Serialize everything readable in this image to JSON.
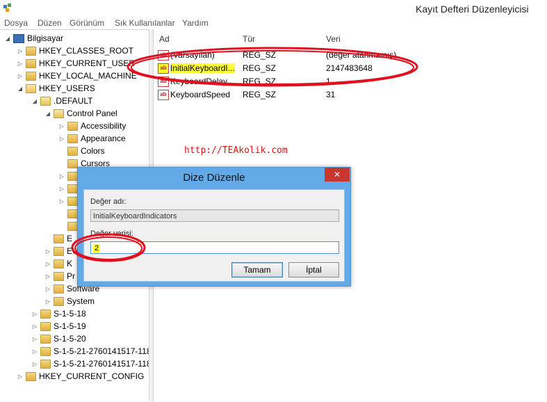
{
  "window": {
    "title": "Kayıt Defteri Düzenleyicisi",
    "icon": "registry-editor-icon"
  },
  "menu": [
    "Dosya",
    "Düzen",
    "Görünüm",
    "Sık Kullanılanlar",
    "Yardım"
  ],
  "tree": [
    {
      "label": "Bilgisayar",
      "depth": 0,
      "expander": "open",
      "icon": "computer-icon"
    },
    {
      "label": "HKEY_CLASSES_ROOT",
      "depth": 1,
      "expander": "closed"
    },
    {
      "label": "HKEY_CURRENT_USER",
      "depth": 1,
      "expander": "closed"
    },
    {
      "label": "HKEY_LOCAL_MACHINE",
      "depth": 1,
      "expander": "closed"
    },
    {
      "label": "HKEY_USERS",
      "depth": 1,
      "expander": "open"
    },
    {
      "label": ".DEFAULT",
      "depth": 2,
      "expander": "open"
    },
    {
      "label": "Control Panel",
      "depth": 3,
      "expander": "open"
    },
    {
      "label": "Accessibility",
      "depth": 4,
      "expander": "closed"
    },
    {
      "label": "Appearance",
      "depth": 4,
      "expander": "closed"
    },
    {
      "label": "Colors",
      "depth": 4,
      "expander": "none"
    },
    {
      "label": "Cursors",
      "depth": 4,
      "expander": "none"
    },
    {
      "label": "",
      "depth": 4,
      "expander": "closed"
    },
    {
      "label": "",
      "depth": 4,
      "expander": "closed"
    },
    {
      "label": "",
      "depth": 4,
      "expander": "closed"
    },
    {
      "label": "",
      "depth": 4,
      "expander": "none"
    },
    {
      "label": "",
      "depth": 4,
      "expander": "none"
    },
    {
      "label": "E",
      "depth": 3,
      "expander": "none"
    },
    {
      "label": "EU",
      "depth": 3,
      "expander": "closed"
    },
    {
      "label": "K",
      "depth": 3,
      "expander": "closed"
    },
    {
      "label": "Pr",
      "depth": 3,
      "expander": "closed"
    },
    {
      "label": "Software",
      "depth": 3,
      "expander": "closed"
    },
    {
      "label": "System",
      "depth": 3,
      "expander": "closed"
    },
    {
      "label": "S-1-5-18",
      "depth": 2,
      "expander": "closed"
    },
    {
      "label": "S-1-5-19",
      "depth": 2,
      "expander": "closed"
    },
    {
      "label": "S-1-5-20",
      "depth": 2,
      "expander": "closed"
    },
    {
      "label": "S-1-5-21-2760141517-118",
      "depth": 2,
      "expander": "closed"
    },
    {
      "label": "S-1-5-21-2760141517-118",
      "depth": 2,
      "expander": "closed"
    },
    {
      "label": "HKEY_CURRENT_CONFIG",
      "depth": 1,
      "expander": "closed"
    }
  ],
  "list": {
    "columns": {
      "name": "Ad",
      "type": "Tür",
      "data": "Veri"
    },
    "rows": [
      {
        "name": "(Varsayılan)",
        "type": "REG_SZ",
        "data": "(değer atanmamış)",
        "highlight": false
      },
      {
        "name": "InitialKeyboardI...",
        "type": "REG_SZ",
        "data": "2147483648",
        "highlight": true
      },
      {
        "name": "KeyboardDelay",
        "type": "REG_SZ",
        "data": "1",
        "highlight": false
      },
      {
        "name": "KeyboardSpeed",
        "type": "REG_SZ",
        "data": "31",
        "highlight": false
      }
    ]
  },
  "watermark": "http://TEAkolik.com",
  "dialog": {
    "title": "Dize Düzenle",
    "close": "✕",
    "name_label": "Değer adı:",
    "name_value": "InitialKeyboardIndicators",
    "data_label": "Değer verisi:",
    "data_value": "2",
    "ok_label": "Tamam",
    "cancel_label": "İptal"
  },
  "colors": {
    "annotation": "#e01020",
    "highlight": "#ffff33",
    "dialog_frame": "#61a9e7",
    "close_button": "#c7372f"
  }
}
